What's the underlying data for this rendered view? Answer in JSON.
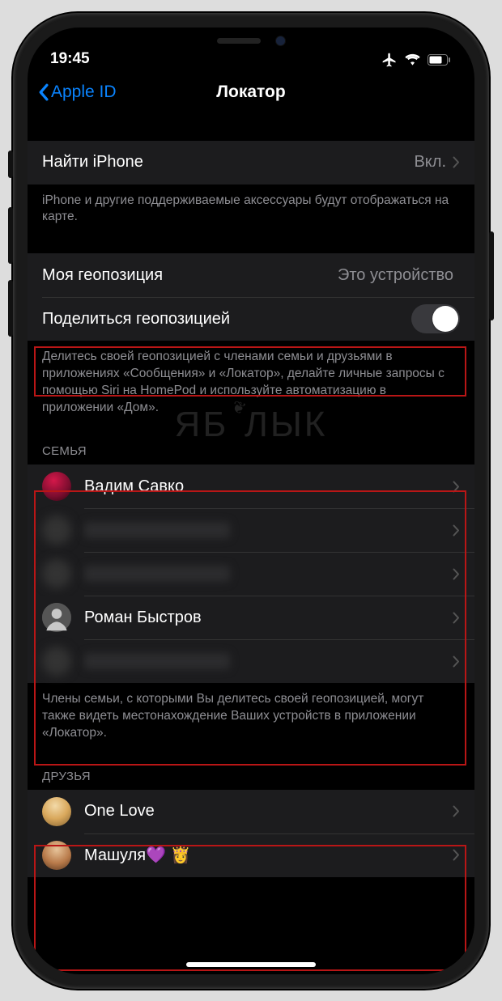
{
  "status": {
    "time": "19:45"
  },
  "nav": {
    "back_label": "Apple ID",
    "title": "Локатор"
  },
  "find_iphone": {
    "label": "Найти iPhone",
    "value": "Вкл.",
    "footer": "iPhone и другие поддерживаемые аксессуары будут отображаться на карте."
  },
  "my_location": {
    "label": "Моя геопозиция",
    "value": "Это устройство"
  },
  "share_location": {
    "label": "Поделиться геопозицией",
    "footer": "Делитесь своей геопозицией с членами семьи и друзьями в приложениях «Сообщения» и «Локатор», делайте личные запросы с помощью Siri на HomePod и используйте автоматизацию в приложении «Дом»."
  },
  "family": {
    "header": "СЕМЬЯ",
    "members": [
      {
        "name": "Вадим Савко",
        "avatar": "color1",
        "blurred": false
      },
      {
        "name": "",
        "avatar": "blur",
        "blurred": true
      },
      {
        "name": "",
        "avatar": "blur",
        "blurred": true
      },
      {
        "name": "Роман Быстров",
        "avatar": "generic",
        "blurred": false
      },
      {
        "name": "",
        "avatar": "blur",
        "blurred": true
      }
    ],
    "footer": "Члены семьи, с которыми Вы делитесь своей геопозицией, могут также видеть местонахождение Ваших устройств в приложении «Локатор»."
  },
  "friends": {
    "header": "ДРУЗЬЯ",
    "members": [
      {
        "name": "One Love",
        "avatar": "color2"
      },
      {
        "name": "Машуля💜 👸",
        "avatar": "color3"
      }
    ]
  },
  "watermark": "ЯБЛЫК"
}
